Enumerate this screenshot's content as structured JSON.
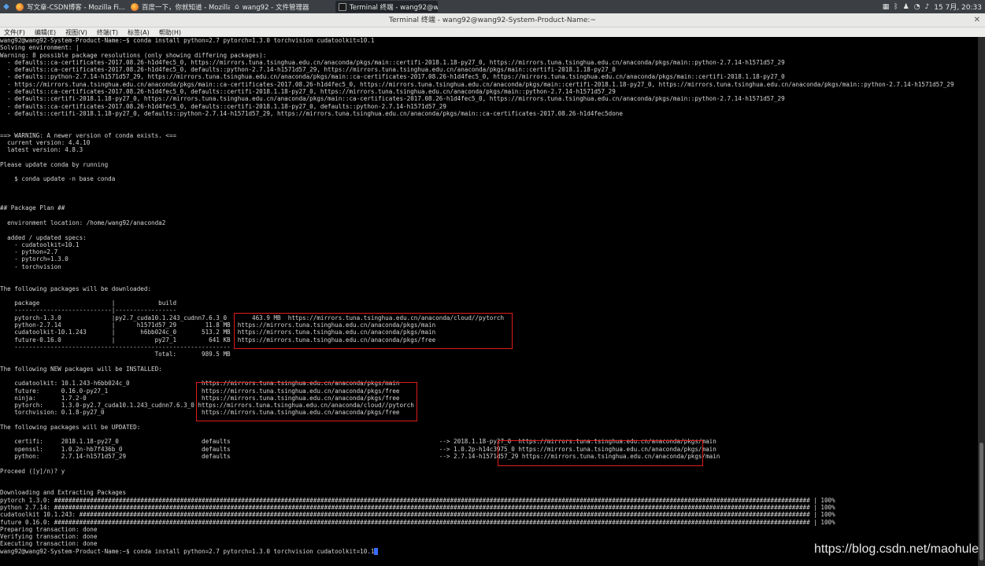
{
  "taskbar": {
    "tasks": [
      {
        "label": "写文章-CSDN博客 - Mozilla Fi...",
        "icon": "firefox-icon"
      },
      {
        "label": "百度一下，你就知道 - Mozilla...",
        "icon": "firefox-icon"
      },
      {
        "label": "wang92 - 文件管理器",
        "icon": "home-folder-icon"
      },
      {
        "label": "Terminal 终端 - wang92@wa...",
        "icon": "terminal-icon"
      }
    ],
    "clock": "15 7月, 20:33"
  },
  "window": {
    "title": "Terminal 终端 - wang92@wang92-System-Product-Name:~",
    "menu": [
      "文件(F)",
      "编辑(E)",
      "视图(V)",
      "终端(T)",
      "标签(A)",
      "帮助(H)"
    ]
  },
  "terminal": {
    "lines": [
      "wang92@wang92-System-Product-Name:~$ conda install python=2.7 pytorch=1.3.0 torchvision cudatoolkit=10.1",
      "Solving environment: |",
      "Warning: 8 possible package resolutions (only showing differing packages):",
      "  - defaults::ca-certificates-2017.08.26-h1d4fec5_0, https://mirrors.tuna.tsinghua.edu.cn/anaconda/pkgs/main::certifi-2018.1.18-py27_0, https://mirrors.tuna.tsinghua.edu.cn/anaconda/pkgs/main::python-2.7.14-h1571d57_29",
      "  - defaults::ca-certificates-2017.08.26-h1d4fec5_0, defaults::python-2.7.14-h1571d57_29, https://mirrors.tuna.tsinghua.edu.cn/anaconda/pkgs/main::certifi-2018.1.18-py27_0",
      "  - defaults::python-2.7.14-h1571d57_29, https://mirrors.tuna.tsinghua.edu.cn/anaconda/pkgs/main::ca-certificates-2017.08.26-h1d4fec5_0, https://mirrors.tuna.tsinghua.edu.cn/anaconda/pkgs/main::certifi-2018.1.18-py27_0",
      "  - https://mirrors.tuna.tsinghua.edu.cn/anaconda/pkgs/main::ca-certificates-2017.08.26-h1d4fec5_0, https://mirrors.tuna.tsinghua.edu.cn/anaconda/pkgs/main::certifi-2018.1.18-py27_0, https://mirrors.tuna.tsinghua.edu.cn/anaconda/pkgs/main::python-2.7.14-h1571d57_29",
      "  - defaults::ca-certificates-2017.08.26-h1d4fec5_0, defaults::certifi-2018.1.18-py27_0, https://mirrors.tuna.tsinghua.edu.cn/anaconda/pkgs/main::python-2.7.14-h1571d57_29",
      "  - defaults::certifi-2018.1.18-py27_0, https://mirrors.tuna.tsinghua.edu.cn/anaconda/pkgs/main::ca-certificates-2017.08.26-h1d4fec5_0, https://mirrors.tuna.tsinghua.edu.cn/anaconda/pkgs/main::python-2.7.14-h1571d57_29",
      "  - defaults::ca-certificates-2017.08.26-h1d4fec5_0, defaults::certifi-2018.1.18-py27_0, defaults::python-2.7.14-h1571d57_29",
      "  - defaults::certifi-2018.1.18-py27_0, defaults::python-2.7.14-h1571d57_29, https://mirrors.tuna.tsinghua.edu.cn/anaconda/pkgs/main::ca-certificates-2017.08.26-h1d4fec5done",
      "",
      "",
      "==> WARNING: A newer version of conda exists. <==",
      "  current version: 4.4.10",
      "  latest version: 4.8.3",
      "",
      "Please update conda by running",
      "",
      "    $ conda update -n base conda",
      "",
      "",
      "",
      "## Package Plan ##",
      "",
      "  environment location: /home/wang92/anaconda2",
      "",
      "  added / updated specs:",
      "    - cudatoolkit=10.1",
      "    - python=2.7",
      "    - pytorch=1.3.0",
      "    - torchvision",
      "",
      "",
      "The following packages will be downloaded:",
      "",
      "    package                    |            build",
      "    ---------------------------|-----------------",
      "    pytorch-1.3.0              |py2.7_cuda10.1.243_cudnn7.6.3_0       463.9 MB  https://mirrors.tuna.tsinghua.edu.cn/anaconda/cloud//pytorch",
      "    python-2.7.14              |      h1571d57_29        11.8 MB  https://mirrors.tuna.tsinghua.edu.cn/anaconda/pkgs/main",
      "    cudatoolkit-10.1.243       |       h6bb024c_0       513.2 MB  https://mirrors.tuna.tsinghua.edu.cn/anaconda/pkgs/main",
      "    future-0.16.0              |           py27_1         641 KB  https://mirrors.tuna.tsinghua.edu.cn/anaconda/pkgs/free",
      "    ------------------------------------------------------------",
      "                                           Total:       989.5 MB",
      "",
      "The following NEW packages will be INSTALLED:",
      "",
      "    cudatoolkit: 10.1.243-h6bb024c_0                    https://mirrors.tuna.tsinghua.edu.cn/anaconda/pkgs/main",
      "    future:      0.16.0-py27_1                          https://mirrors.tuna.tsinghua.edu.cn/anaconda/pkgs/free",
      "    ninja:       1.7.2-0                                https://mirrors.tuna.tsinghua.edu.cn/anaconda/pkgs/free",
      "    pytorch:     1.3.0-py2.7_cuda10.1.243_cudnn7.6.3_0 https://mirrors.tuna.tsinghua.edu.cn/anaconda/cloud//pytorch",
      "    torchvision: 0.1.8-py27_0                           https://mirrors.tuna.tsinghua.edu.cn/anaconda/pkgs/free",
      "",
      "The following packages will be UPDATED:",
      "",
      "    certifi:     2018.1.18-py27_0                       defaults                                                          --> 2018.1.18-py27_0  https://mirrors.tuna.tsinghua.edu.cn/anaconda/pkgs/main",
      "    openssl:     1.0.2n-hb7f436b_0                      defaults                                                          --> 1.0.2p-h14c3975_0 https://mirrors.tuna.tsinghua.edu.cn/anaconda/pkgs/main",
      "    python:      2.7.14-h1571d57_29                     defaults                                                          --> 2.7.14-h1571d57_29 https://mirrors.tuna.tsinghua.edu.cn/anaconda/pkgs/main",
      "",
      "Proceed ([y]/n)? y",
      "",
      "",
      "Downloading and Extracting Packages",
      "pytorch 1.3.0: ################################################################################################################################################################################################################## | 100%",
      "python 2.7.14: ################################################################################################################################################################################################################## | 100%",
      "cudatoolkit 10.1.243: ########################################################################################################################################################################################################### | 100%",
      "future 0.16.0: ################################################################################################################################################################################################################## | 100%",
      "Preparing transaction: done",
      "Verifying transaction: done",
      "Executing transaction: done",
      "wang92@wang92-System-Product-Name:~$ conda install python=2.7 pytorch=1.3.0 torchvision cudatoolkit=10.1"
    ]
  },
  "watermark": "https://blog.csdn.net/maohule",
  "colors": {
    "highlight_box": "#e01c1c",
    "terminal_bg": "#000000",
    "terminal_fg": "#d6d6d6"
  }
}
